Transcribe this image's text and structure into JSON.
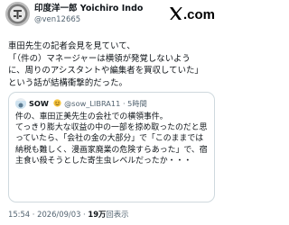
{
  "author": {
    "display_name": "印度洋一郎 Yoichiro Indo",
    "handle": "@ven12665",
    "avatar_icon": "seal-stamp-avatar"
  },
  "brand": {
    "logo_text": "X.com",
    "logo_icon": "x-logo-icon"
  },
  "post": {
    "lines": [
      "車田先生の記者会見を見ていて、",
      "「（件の）マネージャーは横領が発覚しないよう",
      "に、周りのアシスタントや編集者を買収していた」",
      "という話が結構衝撃的だった。"
    ]
  },
  "quote": {
    "name": "SOW",
    "name_icon": "smiling-emoji-icon",
    "handle": "@sow_LIBRA11",
    "time": "5時間",
    "separator": "·",
    "lines": [
      "件の、車田正美先生の会社での横領事件。",
      "てっきり膨大な収益の中の一部を掠め取ったのだと思",
      "っていたら、「会社の金の大部分」で「このままでは",
      "納税も難しく、漫画家廃業の危険すらあった」で、宿",
      "主食い殺そうとした寄生虫レベルだったか・・・"
    ]
  },
  "footer": {
    "timestamp": "15:54 · 2026/09/03 · ",
    "views_count": "19万",
    "views_label": "回表示"
  }
}
